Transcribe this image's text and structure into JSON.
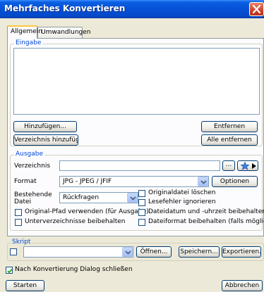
{
  "window": {
    "title": "Mehrfaches Konvertieren"
  },
  "tabs": [
    {
      "label": "Allgemein"
    },
    {
      "label": "Umwandlungen"
    }
  ],
  "eingabe": {
    "legend": "Eingabe",
    "add_label": "Hinzufügen...",
    "add_dir_label": "Verzeichnis hinzufügen...",
    "remove_label": "Entfernen",
    "remove_all_label": "Alle entfernen"
  },
  "ausgabe": {
    "legend": "Ausgabe",
    "directory_label": "Verzeichnis",
    "directory_value": "",
    "browse_label": "...",
    "format_label": "Format",
    "format_value": "JPG - JPEG / JFIF",
    "options_label": "Optionen",
    "existing_label_line1": "Bestehende",
    "existing_label_line2": "Datei",
    "existing_value": "Rückfragen",
    "checkboxes": [
      {
        "label": "Original-Pfad verwenden (für Ausgabe)",
        "checked": false
      },
      {
        "label": "Unterverzeichnisse beibehalten",
        "checked": false
      },
      {
        "label": "Originaldatei löschen",
        "checked": false
      },
      {
        "label": "Lesefehler ignorieren",
        "checked": false
      },
      {
        "label": "Dateidatum und -uhrzeit beibehalten",
        "checked": false
      },
      {
        "label": "Dateiformat beibehalten (falls möglich)",
        "checked": false
      }
    ]
  },
  "skript": {
    "legend": "Skript",
    "enabled": false,
    "value": "",
    "open_label": "Öffnen...",
    "save_label": "Speichern...",
    "export_label": "Exportieren..."
  },
  "close_after": {
    "label": "Nach Konvertierung Dialog schließen",
    "checked": true
  },
  "footer": {
    "start_label": "Starten",
    "cancel_label": "Abbrechen"
  },
  "colors": {
    "titlebar": "#0550d8",
    "legend": "#0046d5",
    "dialog_bg": "#ece9d8",
    "close_button": "#d0402a"
  }
}
